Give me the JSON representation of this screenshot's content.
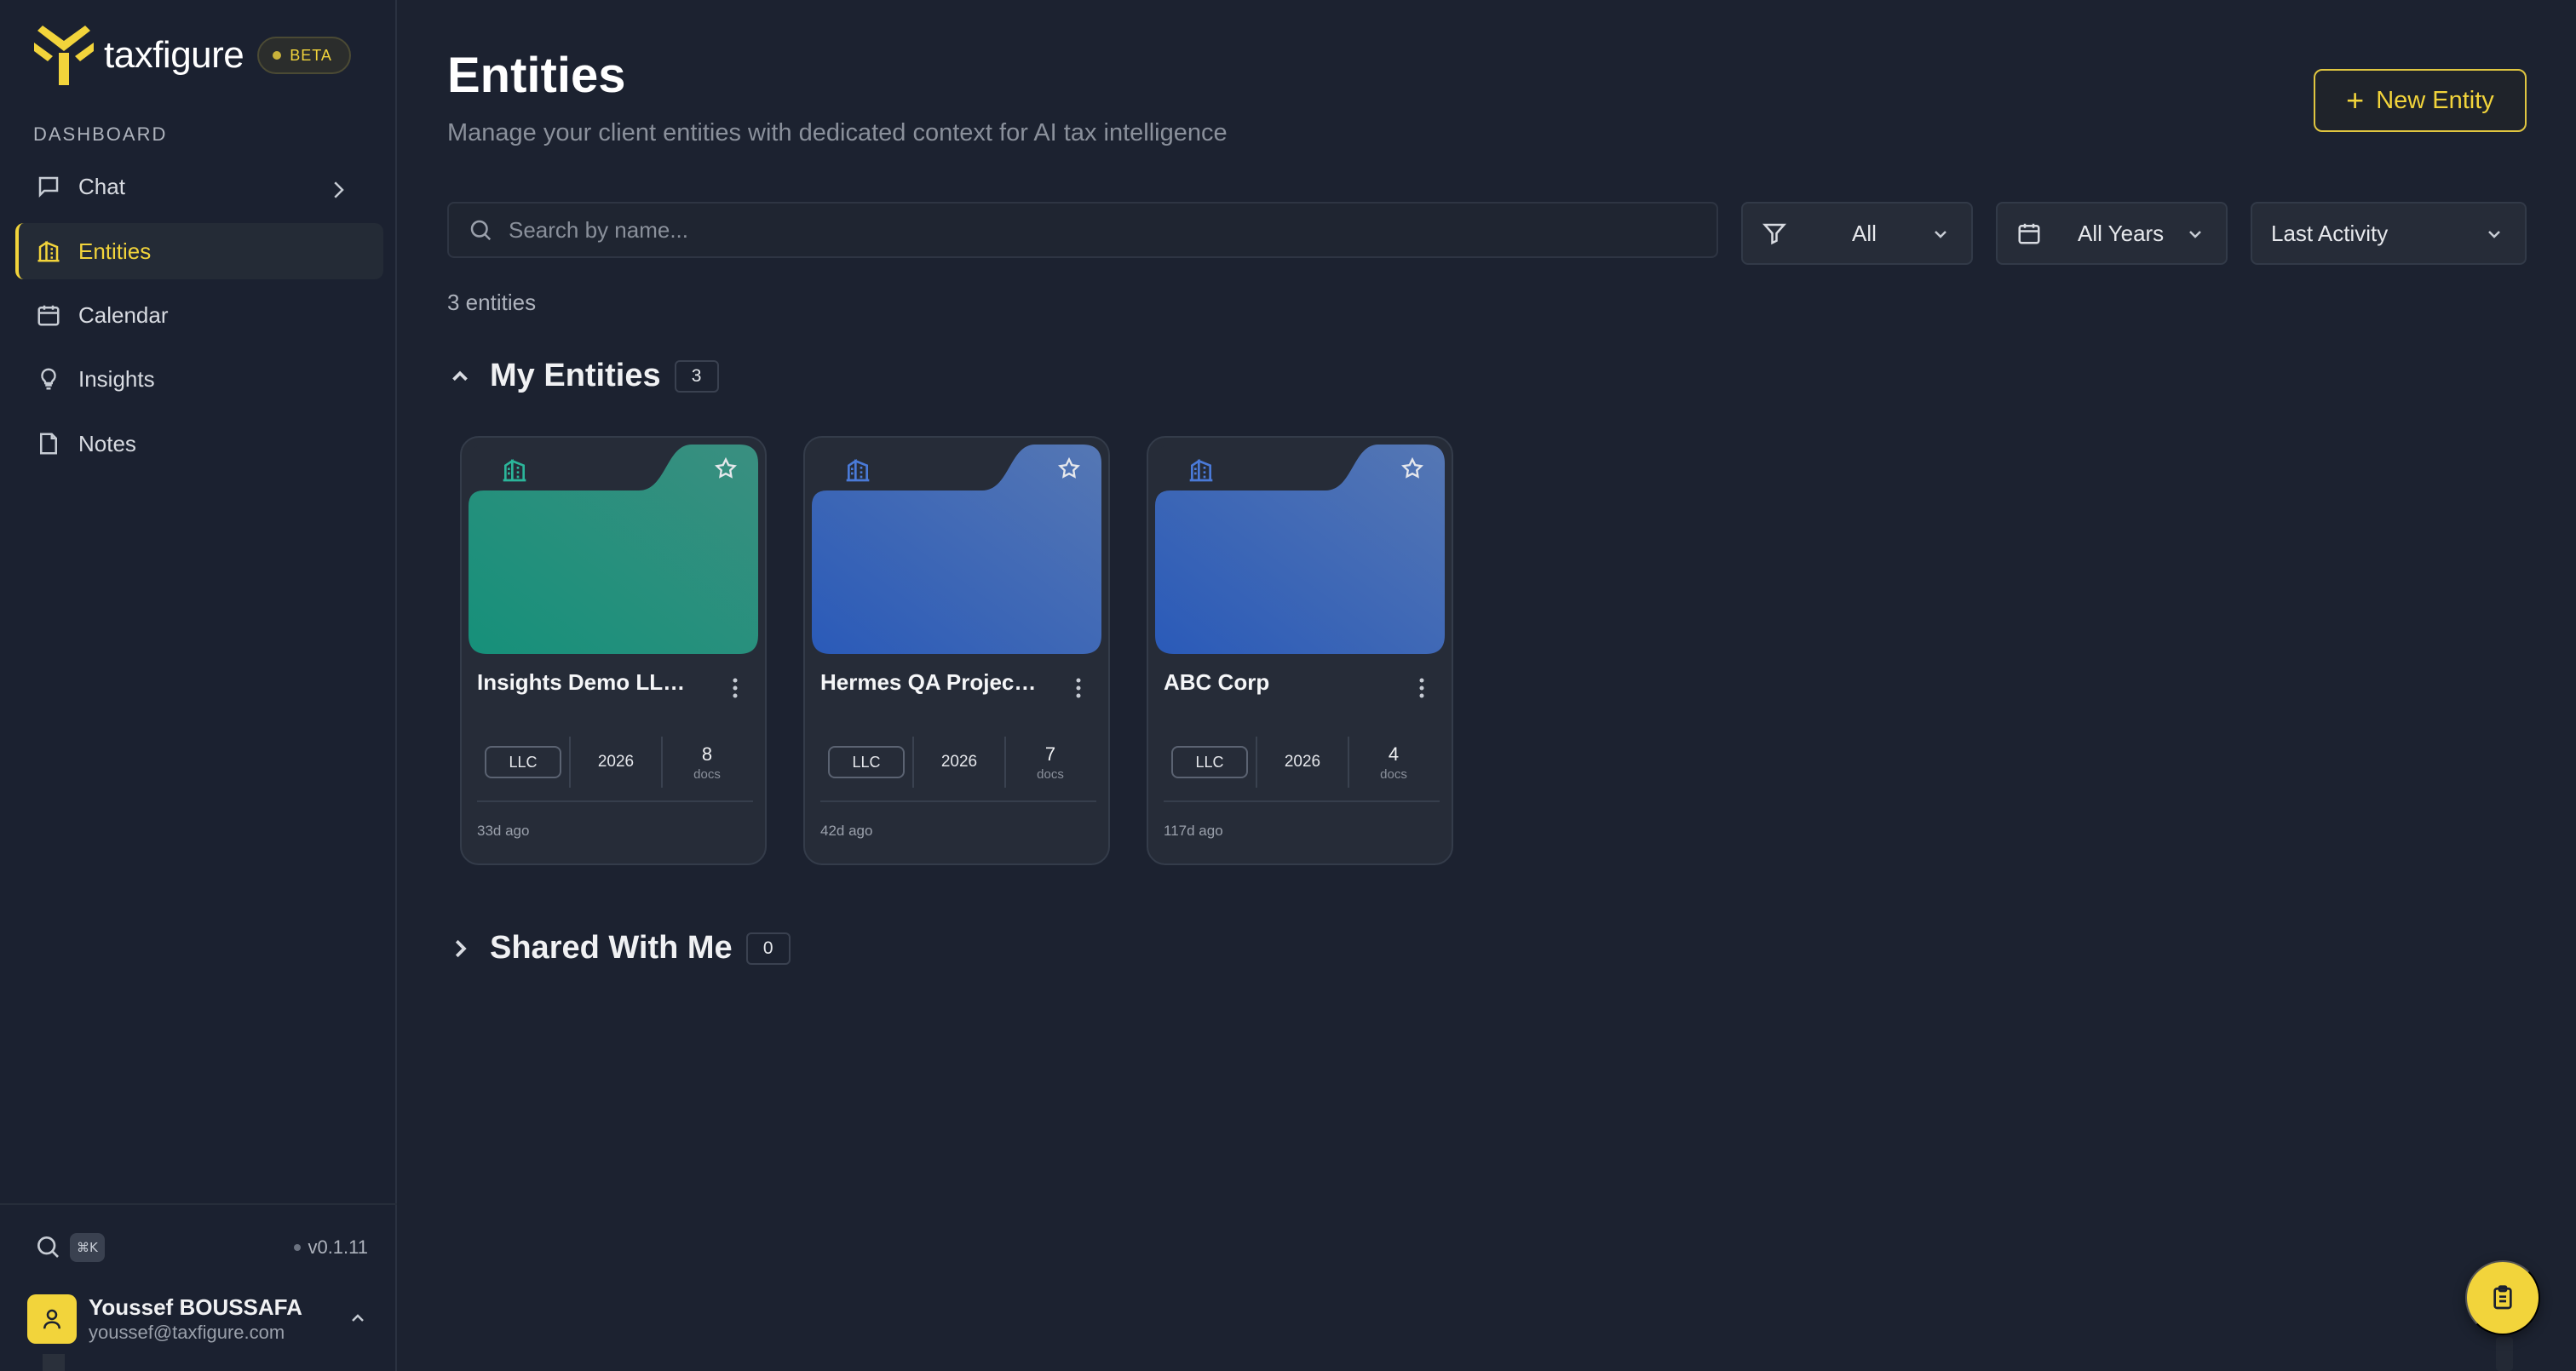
{
  "app": {
    "name": "taxfigure",
    "badge": "BETA"
  },
  "sidebar": {
    "section_label": "DASHBOARD",
    "items": [
      {
        "label": "Chat",
        "icon": "chat-icon",
        "active": false,
        "has_chevron": true
      },
      {
        "label": "Entities",
        "icon": "building-icon",
        "active": true
      },
      {
        "label": "Calendar",
        "icon": "calendar-icon",
        "active": false
      },
      {
        "label": "Insights",
        "icon": "lightbulb-icon",
        "active": false
      },
      {
        "label": "Notes",
        "icon": "note-icon",
        "active": false
      }
    ],
    "shortcut": "⌘K",
    "version": "v0.1.11",
    "user": {
      "name": "Youssef BOUSSAFA",
      "email": "youssef@taxfigure.com"
    }
  },
  "header": {
    "title": "Entities",
    "subtitle": "Manage your client entities with dedicated context for AI tax intelligence",
    "new_button": "New Entity"
  },
  "filters": {
    "search_placeholder": "Search by name...",
    "type_filter": "All",
    "year_filter": "All Years",
    "sort": "Last Activity"
  },
  "entity_count_text": "3 entities",
  "groups": {
    "mine": {
      "title": "My Entities",
      "count": "3",
      "expanded": true
    },
    "shared": {
      "title": "Shared With Me",
      "count": "0",
      "expanded": false
    }
  },
  "entities": [
    {
      "name": "Insights Demo LLC…",
      "type": "LLC",
      "year": "2026",
      "docs": "8",
      "docs_label": "docs",
      "last_activity": "33d ago",
      "color": "#1e8a74",
      "icon_color": "#2bb59a"
    },
    {
      "name": "Hermes QA Projec…",
      "type": "LLC",
      "year": "2026",
      "docs": "7",
      "docs_label": "docs",
      "last_activity": "42d ago",
      "color": "#2f5fb6",
      "icon_color": "#4a7ad8"
    },
    {
      "name": "ABC Corp",
      "type": "LLC",
      "year": "2026",
      "docs": "4",
      "docs_label": "docs",
      "last_activity": "117d ago",
      "color": "#2f5fb6",
      "icon_color": "#4a7ad8"
    }
  ],
  "colors": {
    "accent": "#f2d43b",
    "background": "#1c2230",
    "card": "#262c38"
  }
}
